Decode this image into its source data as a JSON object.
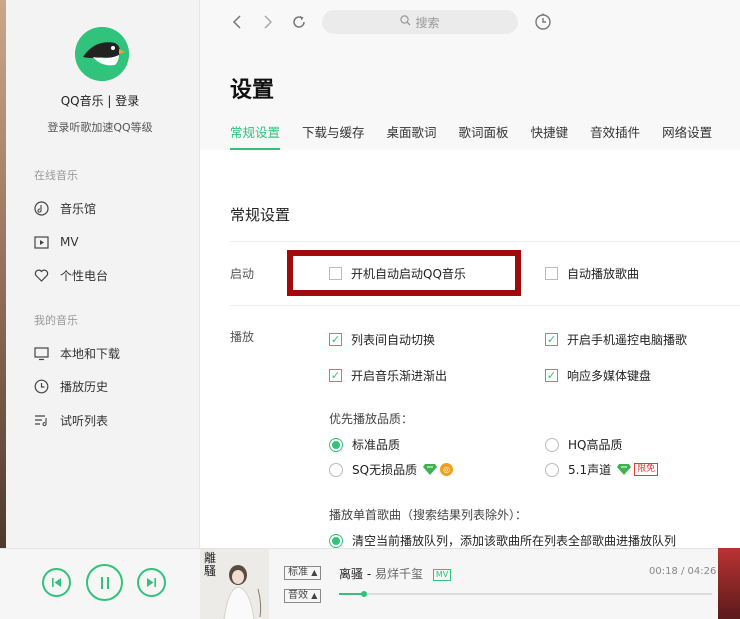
{
  "sidebar": {
    "user_name": "QQ音乐",
    "login_label": "登录",
    "subtitle": "登录听歌加速QQ等级",
    "online_section": "在线音乐",
    "online_items": [
      {
        "label": "音乐馆",
        "icon": "music-hall-icon"
      },
      {
        "label": "MV",
        "icon": "mv-icon"
      },
      {
        "label": "个性电台",
        "icon": "radio-heart-icon"
      }
    ],
    "my_section": "我的音乐",
    "my_items": [
      {
        "label": "本地和下载",
        "icon": "monitor-icon"
      },
      {
        "label": "播放历史",
        "icon": "history-clock-icon"
      },
      {
        "label": "试听列表",
        "icon": "playlist-icon"
      }
    ]
  },
  "topbar": {
    "search_placeholder": "搜索"
  },
  "settings": {
    "title": "设置",
    "tabs": [
      "常规设置",
      "下载与缓存",
      "桌面歌词",
      "歌词面板",
      "快捷键",
      "音效插件",
      "网络设置"
    ],
    "active_tab": 0,
    "section_title": "常规设置",
    "startup_label": "启动",
    "startup_opts": [
      {
        "label": "开机自动启动QQ音乐",
        "checked": false
      },
      {
        "label": "自动播放歌曲",
        "checked": false
      }
    ],
    "play_label": "播放",
    "play_opts": [
      {
        "label": "列表间自动切换",
        "checked": true
      },
      {
        "label": "开启手机遥控电脑播歌",
        "checked": true
      },
      {
        "label": "开启音乐渐进渐出",
        "checked": true
      },
      {
        "label": "响应多媒体键盘",
        "checked": true
      }
    ],
    "quality_label": "优先播放品质：",
    "quality_opts": [
      {
        "label": "标准品质",
        "selected": true
      },
      {
        "label": "HQ高品质",
        "selected": false
      },
      {
        "label": "SQ无损品质",
        "selected": false
      },
      {
        "label": "5.1声道",
        "selected": false
      }
    ],
    "surround_badge": "限免",
    "single_label": "播放单首歌曲（搜索结果列表除外）：",
    "single_opt": "清空当前播放队列，添加该歌曲所在列表全部歌曲进播放队列"
  },
  "player": {
    "quality_btn": "标准",
    "effect_btn": "音效",
    "song_title": "离骚",
    "artist": "易烊千玺",
    "mv_tag": "MV",
    "time": "00:18 / 04:26",
    "progress": 0.068,
    "cover_text": "離騷",
    "accent": "#31c27c"
  }
}
